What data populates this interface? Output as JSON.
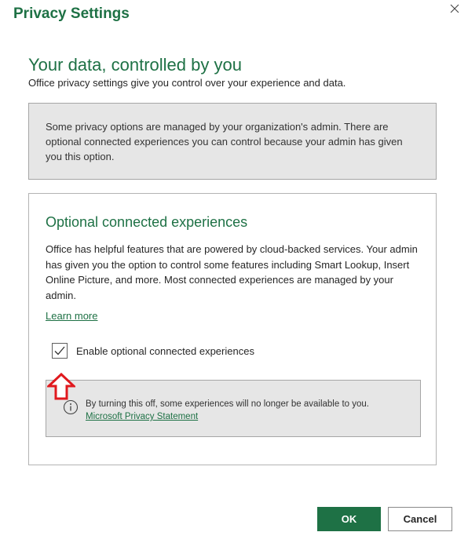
{
  "dialog": {
    "title": "Privacy Settings",
    "close_icon": "close-icon"
  },
  "main": {
    "heading": "Your data, controlled by you",
    "subheading": "Office privacy settings give you control over your experience and data.",
    "admin_note": "Some privacy options are managed by your organization's admin. There are optional connected experiences you can control because your admin has given you this option."
  },
  "panel": {
    "title": "Optional connected experiences",
    "description": "Office has helpful features that are powered by cloud-backed services. Your admin has given you the option to control some features including Smart Lookup, Insert Online Picture, and more. Most connected experiences are managed by your admin.",
    "learn_more": "Learn more",
    "checkbox_label": "Enable optional connected experiences",
    "checkbox_checked": true,
    "info_text": "By turning this off, some experiences will no longer be available to you.",
    "info_link": "Microsoft Privacy Statement",
    "info_icon": "info-icon",
    "arrow_icon": "red-up-arrow-icon"
  },
  "footer": {
    "ok_label": "OK",
    "cancel_label": "Cancel"
  },
  "colors": {
    "accent": "#1e7145",
    "note_background": "#e6e6e6",
    "arrow": "#e0191e"
  }
}
